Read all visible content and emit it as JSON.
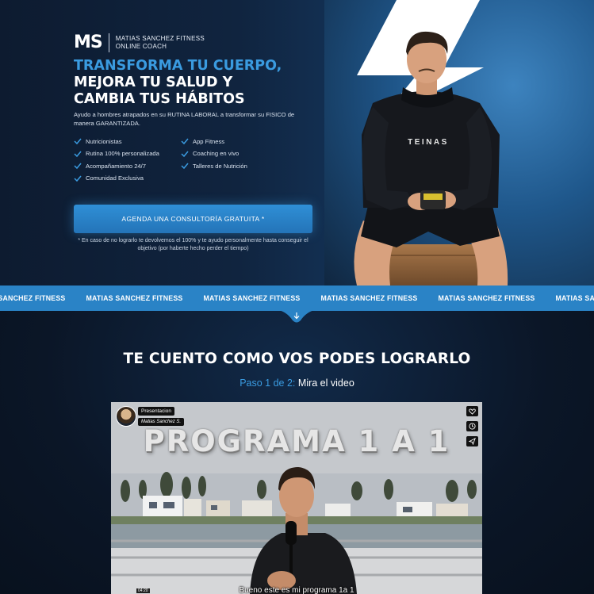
{
  "brand": {
    "logo": "MS",
    "name": "MATIAS SANCHEZ FITNESS",
    "tagline": "ONLINE COACH"
  },
  "hero": {
    "headline_accent": "TRANSFORMA TU CUERPO,",
    "headline_line2": "MEJORA TU SALUD Y",
    "headline_line3": "CAMBIA TUS HÁBITOS",
    "intro": "Ayudo a hombres atrapados en su RUTINA LABORAL a transformar su FISICO de manera GARANTIZADA.",
    "features": [
      "Nutricionistas",
      "App Fitness",
      "Rutina 100% personalizada",
      "Coaching en vivo",
      "Acompañamiento 24/7",
      "Talleres de Nutrición",
      "Comunidad Exclusiva"
    ],
    "cta_label": "AGENDA UNA CONSULTORÍA GRATUITA *",
    "cta_note": "* En caso de no lograrlo te devolvemos el 100% y te ayudo personalmente hasta conseguir el objetivo (por haberte hecho perder el tiempo)",
    "hoodie_text": "TEINAS"
  },
  "marquee": {
    "items": [
      "MATIAS SANCHEZ FITNESS",
      "MATIAS SANCHEZ FITNESS",
      "MATIAS SANCHEZ FITNESS",
      "MATIAS SANCHEZ FITNESS",
      "MATIAS SANCHEZ FITNESS",
      "MATIAS SANCHEZ FITNESS"
    ]
  },
  "section": {
    "title": "TE CUENTO COMO VOS PODES LOGRARLO",
    "step_prefix": "Paso 1 de 2:",
    "step_text": "Mira el video"
  },
  "video": {
    "channel": "Presentacion",
    "author": "Matias Sanchez S.",
    "heading": "PROGRAMA 1 A 1",
    "subtitle": "Bueno este es mi programa 1a 1",
    "timestamp": "04:20"
  },
  "colors": {
    "accent": "#3a9be0",
    "cta": "#2a83c6",
    "background": "#0b1424"
  },
  "icons": [
    "check-icon",
    "heart-icon",
    "clock-icon",
    "share-icon",
    "arrow-down-icon",
    "bolt-graphic"
  ]
}
